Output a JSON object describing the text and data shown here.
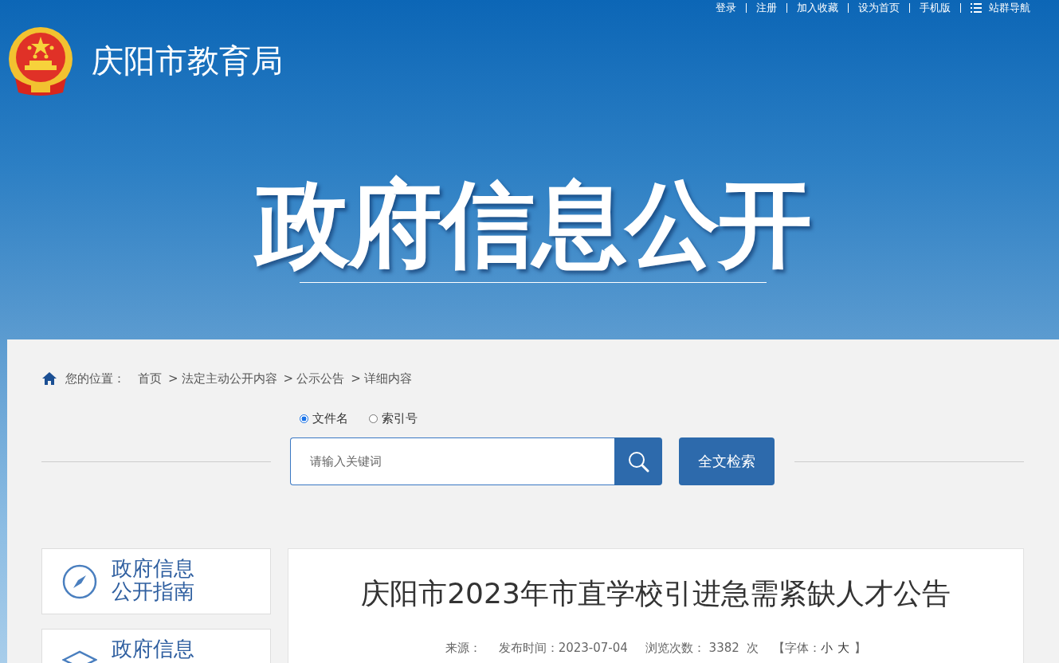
{
  "top_links": [
    {
      "label": "登录",
      "kind": "link"
    },
    {
      "label": "注册",
      "kind": "link"
    },
    {
      "label": "加入收藏",
      "kind": "link"
    },
    {
      "label": "设为首页",
      "kind": "link"
    },
    {
      "label": "手机版",
      "kind": "link"
    },
    {
      "label": "站群导航",
      "kind": "menu"
    }
  ],
  "header": {
    "site_name": "庆阳市教育局",
    "banner_title": "政府信息公开"
  },
  "breadcrumb": {
    "label": "您的位置：",
    "separator": ">",
    "items": [
      "首页",
      "法定主动公开内容",
      "公示公告",
      "详细内容"
    ]
  },
  "search": {
    "options": [
      {
        "label": "文件名",
        "selected": true
      },
      {
        "label": "索引号",
        "selected": false
      }
    ],
    "placeholder": "请输入关键词",
    "submit_button": "全文检索"
  },
  "sidebar": [
    {
      "kind": "compass",
      "lines": [
        "政府信息",
        "公开指南"
      ]
    },
    {
      "kind": "layers",
      "lines": [
        "政府信息"
      ]
    }
  ],
  "article": {
    "title": "庆阳市2023年市直学校引进急需紧缺人才公告",
    "source_label": "来源：",
    "date_label": "发布时间：",
    "date": "2023-07-04",
    "views_label": "浏览次数：",
    "views": "3382",
    "views_unit": "次",
    "font_open": "【字体：",
    "font_small": "小",
    "font_large": "大",
    "font_close": "】"
  }
}
